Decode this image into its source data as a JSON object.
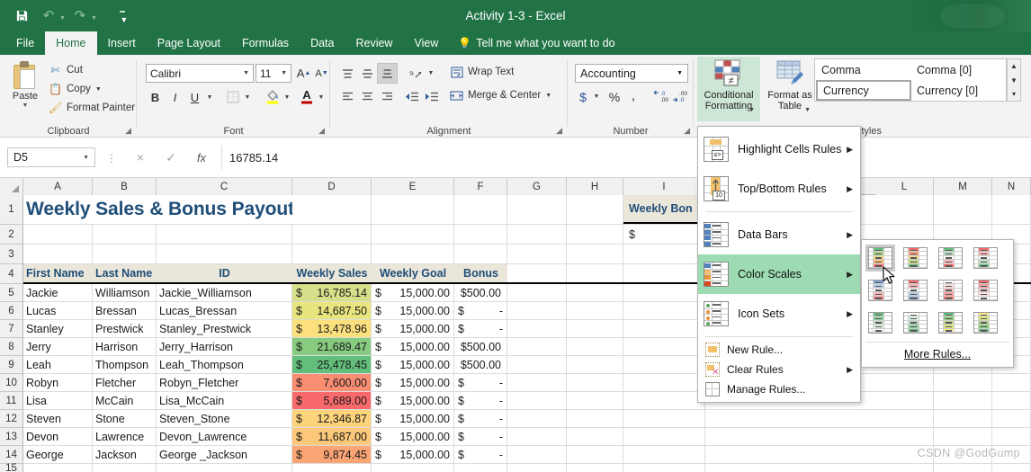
{
  "window": {
    "title": "Activity 1-3 - Excel",
    "quick_access": [
      {
        "name": "save-icon",
        "glyph": "💾"
      },
      {
        "name": "undo-icon",
        "glyph": "↶"
      },
      {
        "name": "redo-icon",
        "glyph": "↷"
      },
      {
        "name": "customize-qat-icon",
        "glyph": "☰"
      }
    ]
  },
  "ribbon": {
    "tabs": [
      {
        "label": "File",
        "active": false
      },
      {
        "label": "Home",
        "active": true
      },
      {
        "label": "Insert",
        "active": false
      },
      {
        "label": "Page Layout",
        "active": false
      },
      {
        "label": "Formulas",
        "active": false
      },
      {
        "label": "Data",
        "active": false
      },
      {
        "label": "Review",
        "active": false
      },
      {
        "label": "View",
        "active": false
      }
    ],
    "tell_me": "Tell me what you want to do",
    "groups": {
      "clipboard": {
        "label": "Clipboard",
        "paste": "Paste",
        "cut": "Cut",
        "copy": "Copy",
        "format_painter": "Format Painter"
      },
      "font": {
        "label": "Font",
        "font_name": "Calibri",
        "font_size": "11",
        "bold": "B",
        "italic": "I",
        "underline": "U"
      },
      "alignment": {
        "label": "Alignment",
        "wrap_text": "Wrap Text",
        "merge_center": "Merge & Center"
      },
      "number": {
        "label": "Number",
        "format": "Accounting",
        "currency": "$",
        "percent": "%",
        "comma": ",",
        "decrease_decimal": ".00",
        "increase_decimal": ".00"
      },
      "styles": {
        "label": "Styles",
        "conditional_formatting": "Conditional Formatting",
        "format_as_table": "Format as Table",
        "cell_styles_items": [
          {
            "label": "Comma",
            "selected": false
          },
          {
            "label": "Comma [0]",
            "selected": false
          },
          {
            "label": "Currency",
            "selected": true
          },
          {
            "label": "Currency [0]",
            "selected": false
          }
        ]
      }
    }
  },
  "formula_bar": {
    "name_box": "D5",
    "cancel": "×",
    "enter": "✓",
    "fx": "fx",
    "value": "16785.14"
  },
  "menu": {
    "items": [
      {
        "label": "Highlight Cells Rules",
        "accel": "H",
        "submenu": true,
        "highlighted": false,
        "icon": "highlight-cells-rules-icon"
      },
      {
        "label": "Top/Bottom Rules",
        "accel": "T",
        "submenu": true,
        "highlighted": false,
        "icon": "top-bottom-rules-icon"
      },
      {
        "label": "Data Bars",
        "accel": "D",
        "submenu": true,
        "highlighted": false,
        "icon": "data-bars-icon"
      },
      {
        "label": "Color Scales",
        "accel": "S",
        "submenu": true,
        "highlighted": true,
        "icon": "color-scales-icon"
      },
      {
        "label": "Icon Sets",
        "accel": "I",
        "submenu": true,
        "highlighted": false,
        "icon": "icon-sets-icon"
      },
      {
        "label": "New Rule...",
        "accel": "N",
        "submenu": false,
        "highlighted": false,
        "icon": "new-rule-icon"
      },
      {
        "label": "Clear Rules",
        "accel": "C",
        "submenu": true,
        "highlighted": false,
        "icon": "clear-rules-icon"
      },
      {
        "label": "Manage Rules...",
        "accel": "R",
        "submenu": false,
        "highlighted": false,
        "icon": "manage-rules-icon"
      }
    ]
  },
  "color_scales_flyout": {
    "more_rules": "More Rules...",
    "thumbs": [
      {
        "name": "green-yellow-red-color-scale",
        "selected": true,
        "colors": [
          "#63be7b",
          "#a9d07f",
          "#f7e07f",
          "#f6b878",
          "#f8696b"
        ]
      },
      {
        "name": "red-yellow-green-color-scale",
        "selected": false,
        "colors": [
          "#f8696b",
          "#f6a07a",
          "#fbdc7f",
          "#bcd880",
          "#63be7b"
        ]
      },
      {
        "name": "green-white-red-color-scale",
        "selected": false,
        "colors": [
          "#63be7b",
          "#b4dcbd",
          "#ffffff",
          "#f6b6b8",
          "#f8696b"
        ]
      },
      {
        "name": "red-white-green-color-scale",
        "selected": false,
        "colors": [
          "#f8696b",
          "#f6b6b8",
          "#ffffff",
          "#b4dcbd",
          "#63be7b"
        ]
      },
      {
        "name": "blue-white-red-color-scale",
        "selected": false,
        "colors": [
          "#7c9fd1",
          "#b8cbe6",
          "#ffffff",
          "#f6b6b8",
          "#f8696b"
        ]
      },
      {
        "name": "red-white-blue-color-scale",
        "selected": false,
        "colors": [
          "#f8696b",
          "#f6b6b8",
          "#ffffff",
          "#b8cbe6",
          "#7c9fd1"
        ]
      },
      {
        "name": "white-red-color-scale",
        "selected": false,
        "colors": [
          "#ffffff",
          "#fbdfe0",
          "#f7c3c5",
          "#f49fa2",
          "#f8696b"
        ]
      },
      {
        "name": "red-white-color-scale",
        "selected": false,
        "colors": [
          "#f8696b",
          "#f49fa2",
          "#f7c3c5",
          "#fbdfe0",
          "#ffffff"
        ]
      },
      {
        "name": "green-white-color-scale",
        "selected": false,
        "colors": [
          "#63be7b",
          "#92cfa1",
          "#b9e0c3",
          "#d8edde",
          "#ffffff"
        ]
      },
      {
        "name": "white-green-color-scale",
        "selected": false,
        "colors": [
          "#ffffff",
          "#d8edde",
          "#b9e0c3",
          "#92cfa1",
          "#63be7b"
        ]
      },
      {
        "name": "green-yellow-color-scale",
        "selected": false,
        "colors": [
          "#63be7b",
          "#8ecb80",
          "#b8d880",
          "#d9e482",
          "#fcea83"
        ]
      },
      {
        "name": "yellow-green-color-scale",
        "selected": false,
        "colors": [
          "#fcea83",
          "#d9e482",
          "#b8d880",
          "#8ecb80",
          "#63be7b"
        ]
      }
    ]
  },
  "sheet": {
    "columns": [
      "A",
      "B",
      "C",
      "D",
      "E",
      "F",
      "G",
      "H",
      "I",
      "L",
      "M",
      "N"
    ],
    "row_numbers": [
      "1",
      "2",
      "3",
      "4",
      "5",
      "6",
      "7",
      "8",
      "9",
      "10",
      "11",
      "12",
      "13",
      "14",
      "15"
    ],
    "title": "Weekly Sales & Bonus Payout",
    "side_label": "Weekly Bon",
    "side_value": "$",
    "headers": [
      "First Name",
      "Last Name",
      "ID",
      "Weekly Sales",
      "Weekly Goal",
      "Bonus"
    ],
    "rows": [
      {
        "first": "Jackie",
        "last": "Williamson",
        "id": "Jackie_Williamson",
        "sales_sym": "$",
        "sales": "16,785.14",
        "goal_sym": "$",
        "goal": "15,000.00",
        "bonus_sym": "",
        "bonus": "$500.00",
        "fill": "#d6e08a"
      },
      {
        "first": "Lucas",
        "last": "Bressan",
        "id": "Lucas_Bressan",
        "sales_sym": "$",
        "sales": "14,687.50",
        "goal_sym": "$",
        "goal": "15,000.00",
        "bonus_sym": "$",
        "bonus": "-",
        "fill": "#e8e57f"
      },
      {
        "first": "Stanley",
        "last": "Prestwick",
        "id": "Stanley_Prestwick",
        "sales_sym": "$",
        "sales": "13,478.96",
        "goal_sym": "$",
        "goal": "15,000.00",
        "bonus_sym": "$",
        "bonus": "-",
        "fill": "#fbe07d"
      },
      {
        "first": "Jerry",
        "last": "Harrison",
        "id": "Jerry_Harrison",
        "sales_sym": "$",
        "sales": "21,689.47",
        "goal_sym": "$",
        "goal": "15,000.00",
        "bonus_sym": "",
        "bonus": "$500.00",
        "fill": "#86cb7f"
      },
      {
        "first": "Leah",
        "last": "Thompson",
        "id": "Leah_Thompson",
        "sales_sym": "$",
        "sales": "25,478.45",
        "goal_sym": "$",
        "goal": "15,000.00",
        "bonus_sym": "",
        "bonus": "$500.00",
        "fill": "#63be7b"
      },
      {
        "first": "Robyn",
        "last": "Fletcher",
        "id": "Robyn_Fletcher",
        "sales_sym": "$",
        "sales": "7,600.00",
        "goal_sym": "$",
        "goal": "15,000.00",
        "bonus_sym": "$",
        "bonus": "-",
        "fill": "#f98e72"
      },
      {
        "first": "Lisa",
        "last": "McCain",
        "id": "Lisa_McCain",
        "sales_sym": "$",
        "sales": "5,689.00",
        "goal_sym": "$",
        "goal": "15,000.00",
        "bonus_sym": "$",
        "bonus": "-",
        "fill": "#f8696b"
      },
      {
        "first": "Steven",
        "last": "Stone",
        "id": "Steven_Stone",
        "sales_sym": "$",
        "sales": "12,346.87",
        "goal_sym": "$",
        "goal": "15,000.00",
        "bonus_sym": "$",
        "bonus": "-",
        "fill": "#fdd37c"
      },
      {
        "first": "Devon",
        "last": "Lawrence",
        "id": "Devon_Lawrence",
        "sales_sym": "$",
        "sales": "11,687.00",
        "goal_sym": "$",
        "goal": "15,000.00",
        "bonus_sym": "$",
        "bonus": "-",
        "fill": "#fec87b"
      },
      {
        "first": "George",
        "last": "Jackson",
        "id": "George _Jackson",
        "sales_sym": "$",
        "sales": "9,874.45",
        "goal_sym": "$",
        "goal": "15,000.00",
        "bonus_sym": "$",
        "bonus": "-",
        "fill": "#fba474"
      }
    ],
    "watermark": "CSDN @GodGump"
  },
  "colors": {
    "excel_green": "#217346",
    "title_blue": "#1f4e79",
    "header_fill": "#eae6da",
    "menu_highlight": "#9ddcb2"
  }
}
